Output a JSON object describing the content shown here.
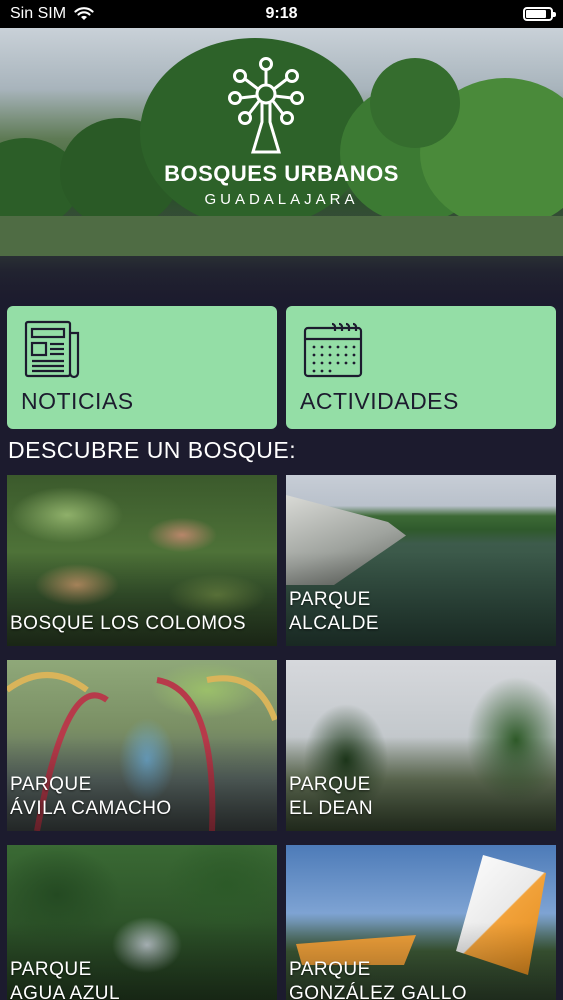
{
  "status_bar": {
    "carrier": "Sin SIM",
    "time": "9:18"
  },
  "hero": {
    "title": "BOSQUES URBANOS",
    "subtitle": "GUADALAJARA"
  },
  "actions": [
    {
      "label": "NOTICIAS",
      "icon": "newspaper-icon"
    },
    {
      "label": "ACTIVIDADES",
      "icon": "calendar-icon"
    }
  ],
  "section_title": "DESCUBRE UN BOSQUE:",
  "parks": [
    {
      "line1": "BOSQUE LOS COLOMOS",
      "line2": ""
    },
    {
      "line1": "PARQUE",
      "line2": "ALCALDE"
    },
    {
      "line1": "PARQUE",
      "line2": "ÁVILA CAMACHO"
    },
    {
      "line1": "PARQUE",
      "line2": "EL DEAN"
    },
    {
      "line1": "PARQUE",
      "line2": "AGUA AZUL"
    },
    {
      "line1": "PARQUE",
      "line2": "GONZÁLEZ GALLO"
    }
  ],
  "colors": {
    "background": "#1c1b2e",
    "accent_green": "#94dea6",
    "text_dark": "#1c1b2e"
  }
}
